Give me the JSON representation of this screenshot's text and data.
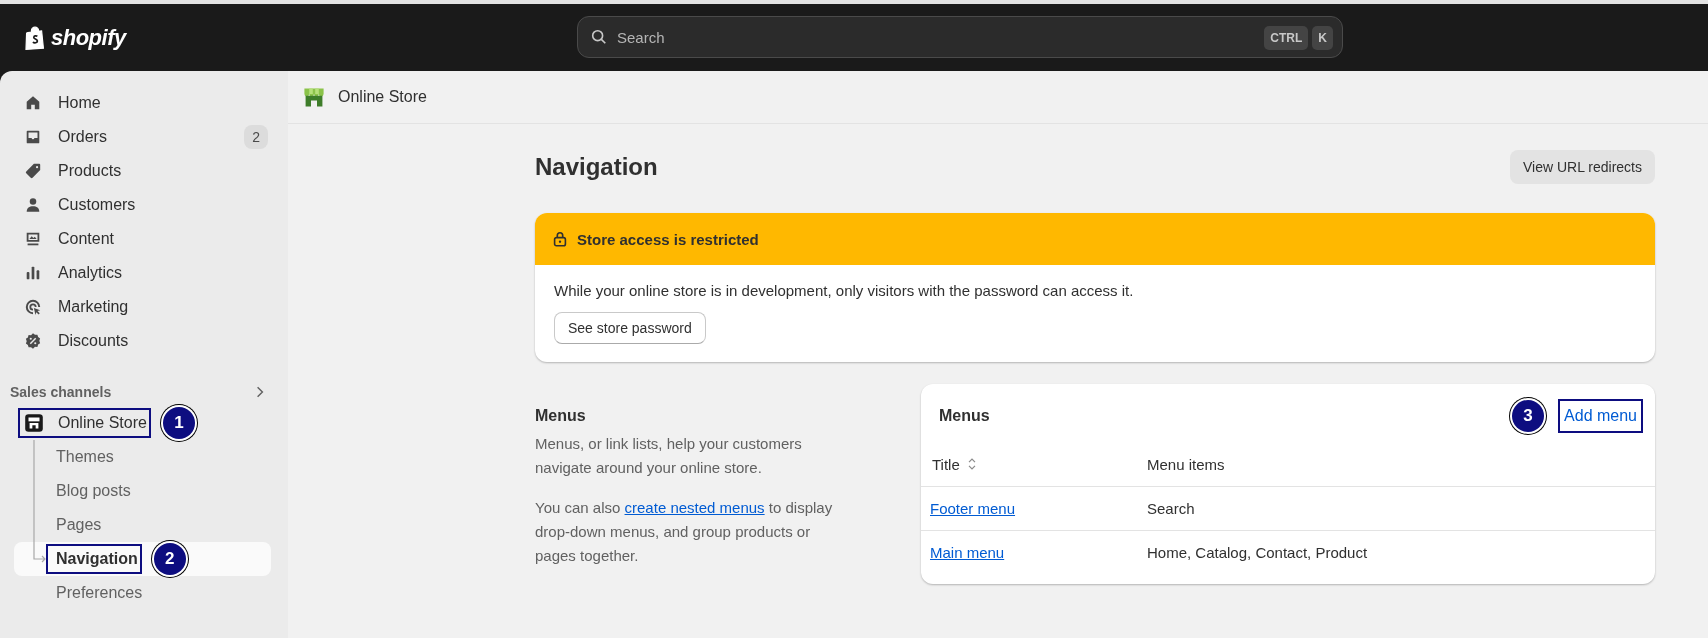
{
  "top_bar": {
    "logo": "shopify",
    "search": {
      "placeholder": "Search",
      "shortcut": [
        "CTRL",
        "K"
      ]
    }
  },
  "sidebar": {
    "items": [
      {
        "label": "Home",
        "selected": false
      },
      {
        "label": "Orders",
        "selected": false,
        "badge": "2"
      },
      {
        "label": "Products",
        "selected": false
      },
      {
        "label": "Customers",
        "selected": false
      },
      {
        "label": "Content",
        "selected": false
      },
      {
        "label": "Analytics",
        "selected": false
      },
      {
        "label": "Marketing",
        "selected": false
      },
      {
        "label": "Discounts",
        "selected": false
      }
    ],
    "section": {
      "title": "Sales channels",
      "channel": {
        "label": "Online Store",
        "highlighted": true,
        "callout": "1",
        "children": [
          {
            "label": "Themes",
            "selected": false,
            "highlighted": false
          },
          {
            "label": "Blog posts",
            "selected": false,
            "highlighted": false
          },
          {
            "label": "Pages",
            "selected": false,
            "highlighted": false
          },
          {
            "label": "Navigation",
            "selected": true,
            "highlighted": true,
            "callout": "2"
          },
          {
            "label": "Preferences",
            "selected": false,
            "highlighted": false
          }
        ]
      }
    }
  },
  "breadcrumb": {
    "title": "Online Store"
  },
  "page": {
    "title": "Navigation",
    "action": "View URL redirects"
  },
  "banner": {
    "title": "Store access is restricted",
    "message": "While your online store is in development, only visitors with the password can access it.",
    "button": "See store password"
  },
  "menus_section": {
    "heading": "Menus",
    "description": "Menus, or link lists, help your customers navigate around your online store.",
    "note": {
      "before": "You can also ",
      "link": "create nested menus",
      "after": " to display drop-down menus, and group products or pages together."
    }
  },
  "menus_card": {
    "title": "Menus",
    "add_button": {
      "label": "Add menu",
      "highlighted": true,
      "callout": "3"
    },
    "columns": [
      {
        "label": "Title",
        "sortable": true
      },
      {
        "label": "Menu items",
        "sortable": false
      }
    ],
    "rows": [
      {
        "title": "Footer menu",
        "items": "Search"
      },
      {
        "title": "Main menu",
        "items": "Home, Catalog, Contact, Product"
      }
    ]
  }
}
